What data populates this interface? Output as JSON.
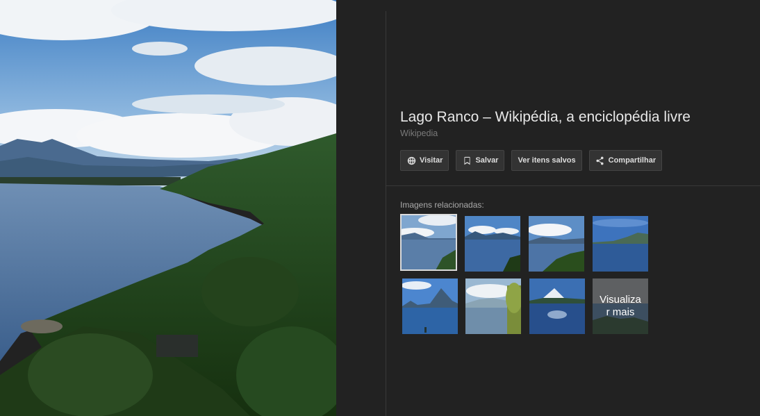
{
  "result": {
    "title": "Lago Ranco – Wikipédia, a enciclopédia livre",
    "source": "Wikipedia"
  },
  "actions": [
    {
      "label": "Visitar",
      "icon": "globe-icon"
    },
    {
      "label": "Salvar",
      "icon": "bookmark-icon"
    },
    {
      "label": "Ver itens salvos",
      "icon": ""
    },
    {
      "label": "Compartilhar",
      "icon": "share-icon"
    }
  ],
  "related": {
    "label": "Imagens relacionadas:",
    "more_label": "Visualizar mais"
  },
  "colors": {
    "panel_bg": "#222222",
    "button_bg": "#333333",
    "title": "#e8e8e8",
    "muted": "#7a7a7a"
  }
}
